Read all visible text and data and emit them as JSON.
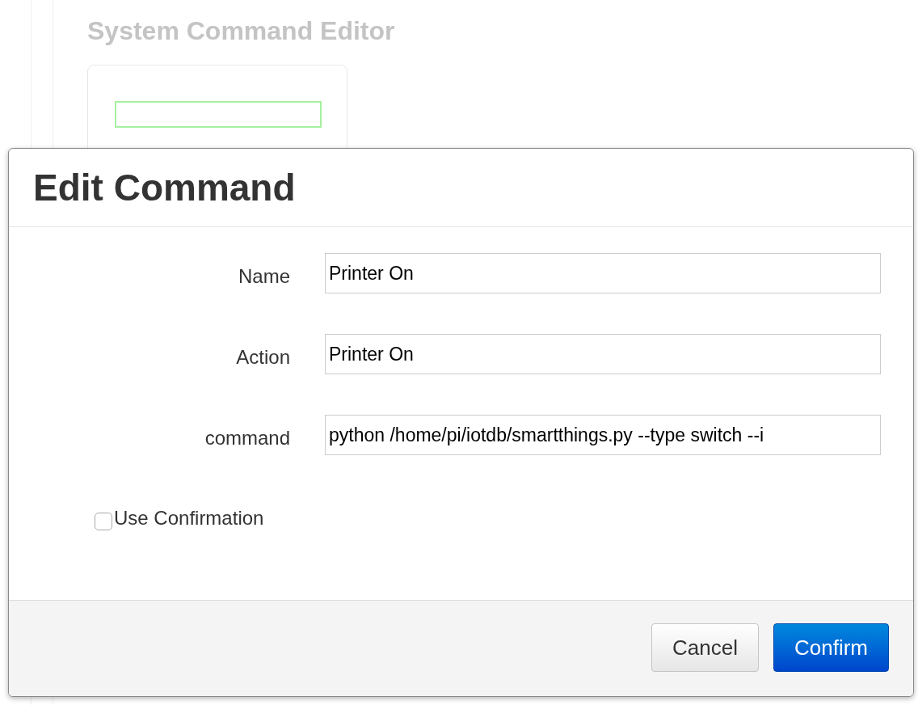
{
  "page": {
    "title": "System Command Editor"
  },
  "dialog": {
    "title": "Edit Command",
    "fields": [
      {
        "label": "Name",
        "value": "Printer On"
      },
      {
        "label": "Action",
        "value": "Printer On"
      },
      {
        "label": "command",
        "value": "python /home/pi/iotdb/smartthings.py --type switch --i"
      }
    ],
    "confirmation": {
      "label": "Use Confirmation",
      "checked": false
    },
    "buttons": [
      {
        "label": "Cancel",
        "kind": "secondary"
      },
      {
        "label": "Confirm",
        "kind": "primary"
      }
    ]
  }
}
